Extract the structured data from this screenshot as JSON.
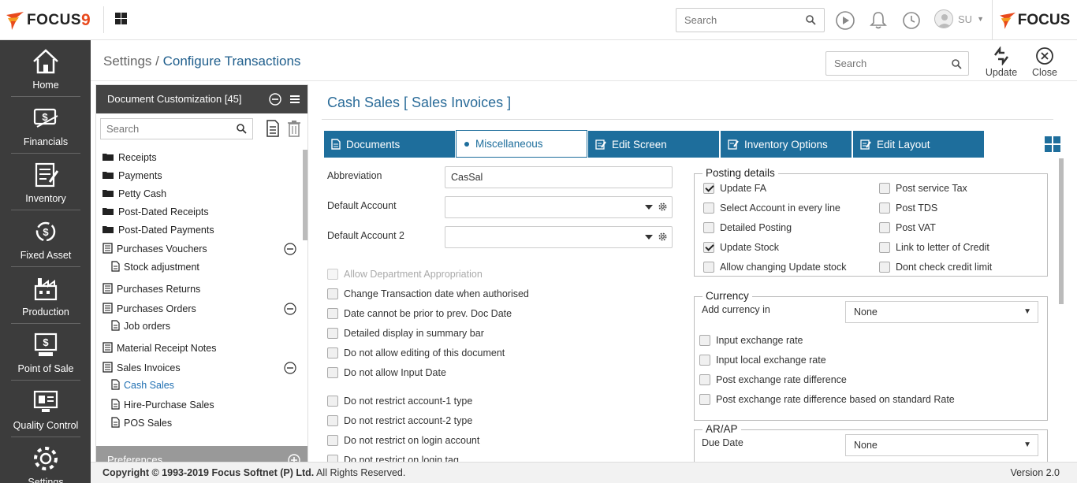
{
  "topbar": {
    "logo_text": "FOCUS",
    "logo_suffix": "9",
    "search_placeholder": "Search",
    "user": "SU",
    "brand_text": "FOCUS"
  },
  "sidebar": {
    "items": [
      {
        "label": "Home",
        "icon": "home-icon"
      },
      {
        "label": "Financials",
        "icon": "financials-icon"
      },
      {
        "label": "Inventory",
        "icon": "inventory-icon"
      },
      {
        "label": "Fixed Asset",
        "icon": "fixed-asset-icon"
      },
      {
        "label": "Production",
        "icon": "production-icon"
      },
      {
        "label": "Point of Sale",
        "icon": "pos-icon"
      },
      {
        "label": "Quality Control",
        "icon": "quality-control-icon"
      },
      {
        "label": "Settings",
        "icon": "settings-icon"
      }
    ]
  },
  "header": {
    "breadcrumb_root": "Settings",
    "breadcrumb_sep": " / ",
    "breadcrumb_current": "Configure Transactions",
    "search_placeholder": "Search",
    "update_label": "Update",
    "close_label": "Close"
  },
  "tree": {
    "title": "Document Customization [45]",
    "search_placeholder": "Search",
    "nodes": [
      {
        "label": "Receipts",
        "type": "folder"
      },
      {
        "label": "Payments",
        "type": "folder"
      },
      {
        "label": "Petty Cash",
        "type": "folder"
      },
      {
        "label": "Post-Dated Receipts",
        "type": "folder"
      },
      {
        "label": "Post-Dated Payments",
        "type": "folder"
      },
      {
        "label": "Purchases Vouchers",
        "type": "doc",
        "collapsible": true
      },
      {
        "label": "Stock adjustment",
        "type": "subdoc"
      },
      {
        "label": "Purchases Returns",
        "type": "doc"
      },
      {
        "label": "Purchases Orders",
        "type": "doc",
        "collapsible": true
      },
      {
        "label": "Job orders",
        "type": "subdoc"
      },
      {
        "label": "Material Receipt Notes",
        "type": "doc"
      },
      {
        "label": "Sales Invoices",
        "type": "doc",
        "collapsible": true
      },
      {
        "label": "Cash Sales",
        "type": "subdoc",
        "selected": true
      },
      {
        "label": "Hire-Purchase Sales",
        "type": "subdoc"
      },
      {
        "label": "POS Sales",
        "type": "subdoc"
      }
    ],
    "preferences_label": "Preferences"
  },
  "panel": {
    "title": "Cash Sales [ Sales Invoices ]",
    "tabs": [
      {
        "label": "Documents"
      },
      {
        "label": "Miscellaneous",
        "active": true
      },
      {
        "label": "Edit Screen"
      },
      {
        "label": "Inventory Options"
      },
      {
        "label": "Edit Layout"
      }
    ],
    "fields": {
      "abbreviation_label": "Abbreviation",
      "abbreviation_value": "CasSal",
      "default_account_label": "Default Account",
      "default_account_value": "",
      "default_account2_label": "Default Account 2",
      "default_account2_value": ""
    },
    "options": [
      {
        "label": "Allow Department Appropriation",
        "checked": false,
        "disabled": true
      },
      {
        "label": "Change Transaction date when authorised",
        "checked": false
      },
      {
        "label": "Date cannot be prior to prev. Doc Date",
        "checked": false
      },
      {
        "label": "Detailed display in summary bar",
        "checked": false
      },
      {
        "label": "Do not allow editing of this document",
        "checked": false
      },
      {
        "label": "Do not allow Input Date",
        "checked": false
      },
      {
        "label": "Do not restrict account-1 type",
        "checked": false
      },
      {
        "label": "Do not restrict account-2 type",
        "checked": false
      },
      {
        "label": "Do not restrict on login account",
        "checked": false
      },
      {
        "label": "Do not restrict on login tag",
        "checked": false
      }
    ],
    "posting": {
      "legend": "Posting details",
      "left": [
        {
          "label": "Update FA",
          "checked": true
        },
        {
          "label": "Select Account in every line",
          "checked": false
        },
        {
          "label": "Detailed Posting",
          "checked": false
        },
        {
          "label": "Update Stock",
          "checked": true
        },
        {
          "label": "Allow changing Update stock",
          "checked": false
        }
      ],
      "right": [
        {
          "label": "Post service Tax",
          "checked": false
        },
        {
          "label": "Post TDS",
          "checked": false
        },
        {
          "label": "Post VAT",
          "checked": false
        },
        {
          "label": "Link to letter of Credit",
          "checked": false
        },
        {
          "label": "Dont check credit limit",
          "checked": false
        }
      ]
    },
    "currency": {
      "legend": "Currency",
      "add_label": "Add currency in",
      "add_value": "None",
      "options": [
        {
          "label": "Input exchange rate",
          "checked": false
        },
        {
          "label": "Input local exchange rate",
          "checked": false
        },
        {
          "label": "Post exchange rate difference",
          "checked": false
        },
        {
          "label": "Post exchange rate difference based on standard Rate",
          "checked": false
        }
      ]
    },
    "arap": {
      "legend": "AR/AP",
      "due_label": "Due Date",
      "due_value": "None"
    }
  },
  "footer": {
    "copyright_prefix": "Copyright © 1993-2019 ",
    "company": "Focus Softnet (P) Ltd.",
    "rights": " All Rights Reserved.",
    "version": "Version 2.0"
  },
  "colors": {
    "accent": "#1e6e9c",
    "sidebar": "#3c3c3c",
    "brand": "#e8491d"
  }
}
